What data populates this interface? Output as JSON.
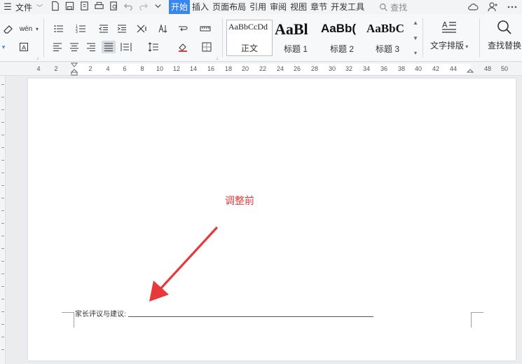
{
  "menu": {
    "file_label": "文件",
    "tabs": [
      "开始",
      "插入",
      "页面布局",
      "引用",
      "审阅",
      "视图",
      "章节",
      "开发工具"
    ],
    "search_label": "查找"
  },
  "ribbon": {
    "phonetic_label": "wén",
    "styles": [
      {
        "sample": "AaBbCcDd",
        "label": "正文"
      },
      {
        "sample": "AaBl",
        "label": "标题 1"
      },
      {
        "sample": "AaBb(",
        "label": "标题 2"
      },
      {
        "sample": "AaBbC",
        "label": "标题 3"
      }
    ],
    "text_layout_label": "文字排版",
    "find_replace_label": "查找替换"
  },
  "ruler": {
    "ticks": [
      "4",
      "2",
      "2",
      "4",
      "6",
      "8",
      "10",
      "12",
      "14",
      "16",
      "18",
      "20",
      "22",
      "24",
      "26",
      "28",
      "30",
      "32",
      "34",
      "36",
      "38",
      "40",
      "42",
      "44",
      "48",
      "50"
    ]
  },
  "document": {
    "annotation": "调整前",
    "line_label": "家长评议与建议:"
  },
  "colors": {
    "accent": "#3a86f0",
    "annotation": "#e03a3a"
  }
}
